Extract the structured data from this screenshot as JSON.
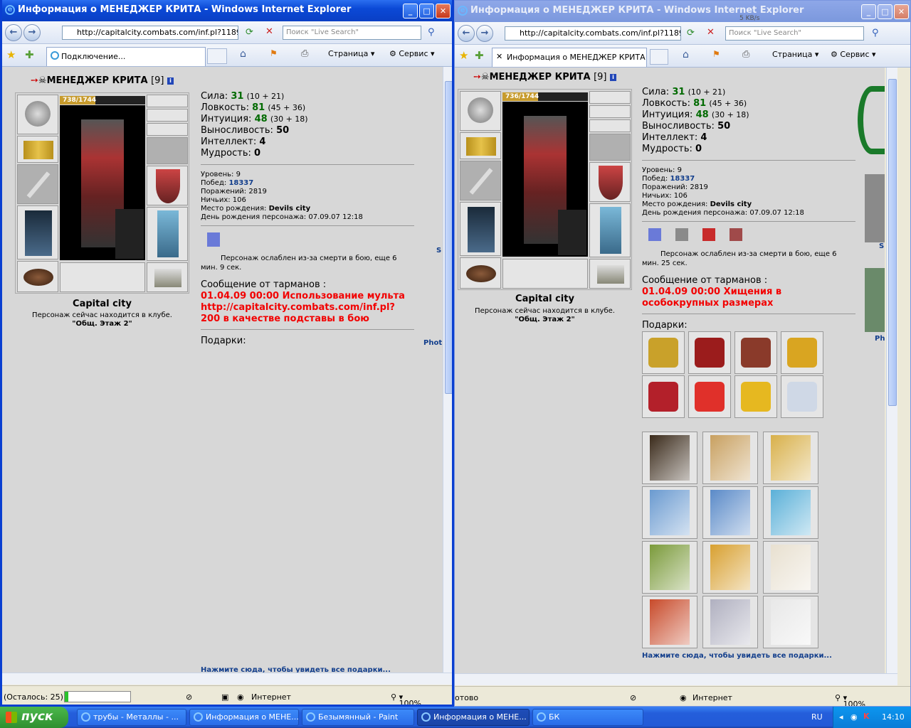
{
  "windowA": {
    "title": "Информация о МЕНЕДЖЕР КРИТА - Windows Internet Explorer",
    "url": "http://capitalcity.combats.com/inf.pl?11891",
    "search_placeholder": "Поиск \"Live Search\"",
    "tab_label": "Подключение...",
    "cmd_page": "Страница",
    "cmd_service": "Сервис",
    "status_left": "(Осталось: 25)",
    "status_zone": "Интернет",
    "status_zoom": "100%",
    "progress": 0.05,
    "char": {
      "name": "МЕНЕДЖЕР КРИТА",
      "level": "[9]",
      "hp": "738/1744",
      "hp_fraction": 0.42,
      "city": "Capital city",
      "club_text": "Персонаж сейчас находится в клубе.",
      "club_room": "\"Общ. Этаж 2\"",
      "stats": [
        {
          "label": "Сила:",
          "value": "31",
          "bonus": "(10 + 21)"
        },
        {
          "label": "Ловкость:",
          "value": "81",
          "bonus": "(45 + 36)"
        },
        {
          "label": "Интуиция:",
          "value": "48",
          "bonus": "(30 + 18)"
        },
        {
          "label": "Выносливость:",
          "value": "50",
          "bonus": ""
        },
        {
          "label": "Интеллект:",
          "value": "4",
          "bonus": ""
        },
        {
          "label": "Мудрость:",
          "value": "0",
          "bonus": ""
        }
      ],
      "info": {
        "level_label": "Уровень:",
        "level_value": "9",
        "wins_label": "Побед:",
        "wins_value": "18337",
        "losses_label": "Поражений:",
        "losses_value": "2819",
        "draws_label": "Ничьих:",
        "draws_value": "106",
        "birthplace_label": "Место рождения:",
        "birthplace_value": "Devils city",
        "birthday_label": "День рождения персонажа:",
        "birthday_value": "07.09.07 12:18"
      },
      "effect": "Персонаж ослаблен из-за смерти в бою, еще 6 мин. 9 сек.",
      "message_head": "Сообщение от тарманов :",
      "message": "01.04.09 00:00 Использование мульта http://capitalcity.combats.com/inf.pl? 200 в качестве подставы в бою",
      "gifts_label": "Подарки:",
      "all_gifts": "Нажмите сюда, чтобы увидеть все подарки...",
      "side_s": "S",
      "side_photo": "Phot"
    }
  },
  "windowB": {
    "title": "Информация о МЕНЕДЖЕР КРИТА - Windows Internet Explorer",
    "url": "http://capitalcity.combats.com/inf.pl?11891",
    "search_placeholder": "Поиск \"Live Search\"",
    "speed": "5 KB/s",
    "tab_label": "Информация о МЕНЕДЖЕР КРИТА",
    "cmd_page": "Страница",
    "cmd_service": "Сервис",
    "status_left": "отово",
    "status_zone": "Интернет",
    "status_zoom": "100%",
    "char": {
      "name": "МЕНЕДЖЕР КРИТА",
      "level": "[9]",
      "hp": "736/1744",
      "hp_fraction": 0.42,
      "city": "Capital city",
      "club_text": "Персонаж сейчас находится в клубе.",
      "club_room": "\"Общ. Этаж 2\"",
      "stats": [
        {
          "label": "Сила:",
          "value": "31",
          "bonus": "(10 + 21)"
        },
        {
          "label": "Ловкость:",
          "value": "81",
          "bonus": "(45 + 36)"
        },
        {
          "label": "Интуиция:",
          "value": "48",
          "bonus": "(30 + 18)"
        },
        {
          "label": "Выносливость:",
          "value": "50",
          "bonus": ""
        },
        {
          "label": "Интеллект:",
          "value": "4",
          "bonus": ""
        },
        {
          "label": "Мудрость:",
          "value": "0",
          "bonus": ""
        }
      ],
      "info": {
        "level_label": "Уровень:",
        "level_value": "9",
        "wins_label": "Побед:",
        "wins_value": "18337",
        "losses_label": "Поражений:",
        "losses_value": "2819",
        "draws_label": "Ничьих:",
        "draws_value": "106",
        "birthplace_label": "Место рождения:",
        "birthplace_value": "Devils city",
        "birthday_label": "День рождения персонажа:",
        "birthday_value": "07.09.07 12:18"
      },
      "effect": "Персонаж ослаблен из-за смерти в бою, еще 6 мин. 25 сек.",
      "message_head": "Сообщение от тарманов :",
      "message": "01.04.09 00:00 Хищения в особокрупных размерах",
      "gifts_label": "Подарки:",
      "all_gifts": "Нажмите сюда, чтобы увидеть все подарки...",
      "side_s": "S",
      "side_photo": "Phot",
      "gift_colors": [
        "#c9a12a",
        "#9b1c1c",
        "#8a3a2a",
        "#d9a521",
        "#b3202a",
        "#e0302a",
        "#e6b820",
        "#cfd8e6"
      ],
      "card_colors": [
        "#3a2a1a",
        "#c8a060",
        "#d8b04a",
        "#6a9ad0",
        "#5a8ac8",
        "#5ab0d8",
        "#7a9a3a",
        "#d8a030",
        "#e8e0d0",
        "#c84a2a",
        "#b0b0c0",
        "#e8e8e8"
      ]
    }
  },
  "taskbar": {
    "start": "пуск",
    "tasks": [
      "трубы - Металлы - ...",
      "Информация о МЕНЕ...",
      "Безымянный - Paint",
      "Информация о МЕНЕ...",
      "БК"
    ],
    "lang": "RU",
    "clock": "14:10"
  }
}
